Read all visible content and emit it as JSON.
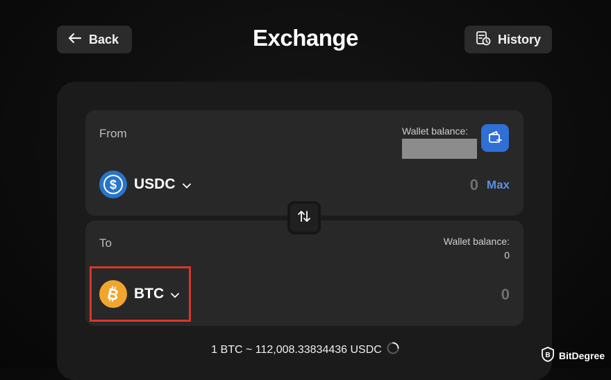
{
  "header": {
    "back_label": "Back",
    "title": "Exchange",
    "history_label": "History"
  },
  "from": {
    "label": "From",
    "wallet_balance_label": "Wallet balance:",
    "token_symbol": "USDC",
    "amount": "0",
    "max_label": "Max"
  },
  "to": {
    "label": "To",
    "wallet_balance_label": "Wallet balance:",
    "wallet_balance_value": "0",
    "token_symbol": "BTC",
    "amount": "0"
  },
  "rate": {
    "text": "1 BTC ~ 112,008.33834436 USDC"
  },
  "watermark": {
    "brand": "BitDegree"
  },
  "colors": {
    "background": "#0d0d0d",
    "card": "#1b1b1b",
    "panel": "#282828",
    "accent_blue": "#2f6fd6",
    "usdc_blue": "#2775ca",
    "btc_orange": "#f1a52f",
    "highlight_red": "#d8372b"
  },
  "icons": [
    "arrow-left-icon",
    "history-icon",
    "wallet-add-icon",
    "usdc-icon",
    "chevron-down-icon",
    "swap-arrows-icon",
    "btc-icon",
    "loading-spinner-icon",
    "bitdegree-logo-icon"
  ]
}
